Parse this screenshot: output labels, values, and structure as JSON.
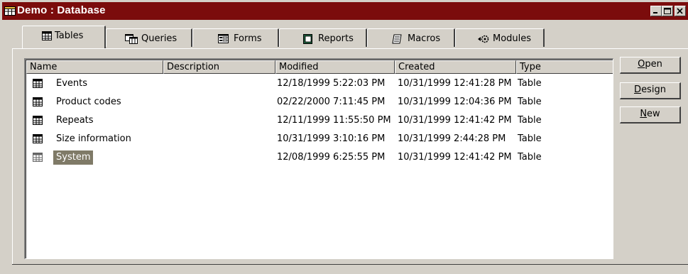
{
  "window": {
    "title": "Demo : Database",
    "title_bar_color": "#7b0c0c",
    "controls": [
      "minimize-icon",
      "maximize-icon",
      "close-icon"
    ]
  },
  "tabs": [
    {
      "label": "Tables",
      "icon": "table-icon",
      "active": true
    },
    {
      "label": "Queries",
      "icon": "query-icon",
      "active": false
    },
    {
      "label": "Forms",
      "icon": "form-icon",
      "active": false
    },
    {
      "label": "Reports",
      "icon": "report-icon",
      "active": false
    },
    {
      "label": "Macros",
      "icon": "macro-icon",
      "active": false
    },
    {
      "label": "Modules",
      "icon": "module-icon",
      "active": false
    }
  ],
  "list": {
    "columns": [
      "Name",
      "Description",
      "Modified",
      "Created",
      "Type"
    ],
    "rows": [
      {
        "name": "Events",
        "description": "",
        "modified": "12/18/1999 5:22:03 PM",
        "created": "10/31/1999 12:41:28 PM",
        "type": "Table",
        "selected": false
      },
      {
        "name": "Product codes",
        "description": "",
        "modified": "02/22/2000 7:11:45 PM",
        "created": "10/31/1999 12:04:36 PM",
        "type": "Table",
        "selected": false
      },
      {
        "name": "Repeats",
        "description": "",
        "modified": "12/11/1999 11:55:50 PM",
        "created": "10/31/1999 12:41:42 PM",
        "type": "Table",
        "selected": false
      },
      {
        "name": "Size information",
        "description": "",
        "modified": "10/31/1999 3:10:16 PM",
        "created": "10/31/1999 2:44:28 PM",
        "type": "Table",
        "selected": false
      },
      {
        "name": "System",
        "description": "",
        "modified": "12/08/1999 6:25:55 PM",
        "created": "10/31/1999 12:41:42 PM",
        "type": "Table",
        "selected": true
      }
    ],
    "selection_color": "#7f7a67"
  },
  "buttons": {
    "open": {
      "accel": "O",
      "rest": "pen"
    },
    "design": {
      "accel": "D",
      "rest": "esign"
    },
    "new": {
      "accel": "N",
      "rest": "ew"
    }
  }
}
